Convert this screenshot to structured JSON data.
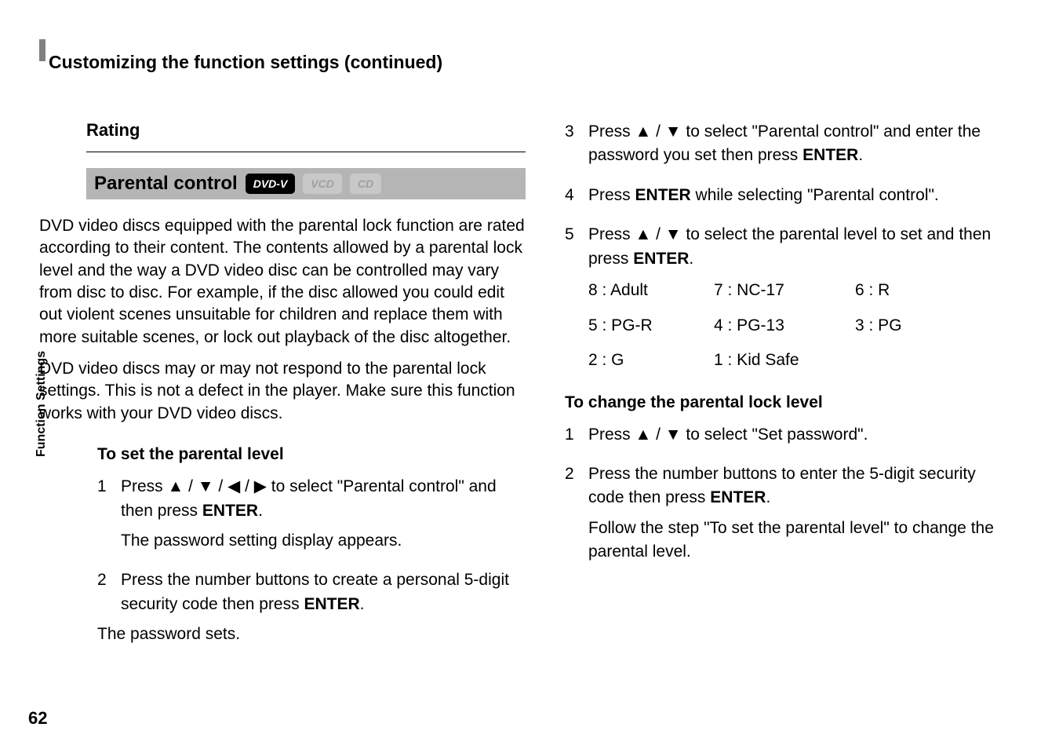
{
  "header": {
    "title": "Customizing the function settings (continued)"
  },
  "sideLabel": "Function Settings",
  "pageNumber": "62",
  "left": {
    "ratingHeading": "Rating",
    "parentalTitle": "Parental control",
    "badges": {
      "dvdv": "DVD-V",
      "vcd": "VCD",
      "cd": "CD"
    },
    "para1": "DVD video discs equipped with the parental lock function are rated according to their content. The contents allowed by a parental lock level and the way a DVD video disc can be controlled may vary from disc to disc. For example, if the disc allowed you could edit out violent scenes unsuitable for children and replace them with more suitable scenes, or lock out playback of the disc altogether.",
    "para2": "DVD video discs may or may not respond to the parental lock settings. This is not a defect in the player. Make sure this function works with your DVD video discs.",
    "subHeading": "To set the parental level",
    "steps": {
      "s1_pre": "Press ",
      "s1_arrows": "▲ / ▼ / ◀ / ▶",
      "s1_mid": " to select \"Parental control\" and then press ",
      "s1_enter": "ENTER",
      "s1_post": ".",
      "s1_note": "The password setting display appears.",
      "s2_pre": "Press the number buttons to create a personal 5-digit security code then press ",
      "s2_enter": "ENTER",
      "s2_post": ".",
      "s2_note": "The password sets."
    }
  },
  "right": {
    "steps": {
      "s3_pre": "Press ",
      "s3_arrows": "▲ / ▼",
      "s3_mid": " to select \"Parental control\" and enter the password you set then press ",
      "s3_enter": "ENTER",
      "s3_post": ".",
      "s4_pre": "Press ",
      "s4_enter": "ENTER",
      "s4_post": " while selecting \"Parental control\".",
      "s5_pre": "Press  ",
      "s5_arrows": "▲ / ▼",
      "s5_mid": " to select the parental level to set and then press ",
      "s5_enter": "ENTER",
      "s5_post": "."
    },
    "ratings": {
      "r8": "8 : Adult",
      "r7": "7 : NC-17",
      "r6": "6 : R",
      "r5": "5 : PG-R",
      "r4": "4 : PG-13",
      "r3": "3 : PG",
      "r2": "2 : G",
      "r1": "1 : Kid Safe"
    },
    "changeHeading": "To change the parental lock level",
    "change": {
      "c1_pre": "Press ",
      "c1_arrows": "▲ / ▼",
      "c1_post": " to select \"Set password\".",
      "c2_pre": "Press the number buttons to enter the 5-digit security code then press ",
      "c2_enter": "ENTER",
      "c2_post": ".",
      "c2_note": "Follow the step \"To set the parental level\" to change the parental level."
    }
  }
}
